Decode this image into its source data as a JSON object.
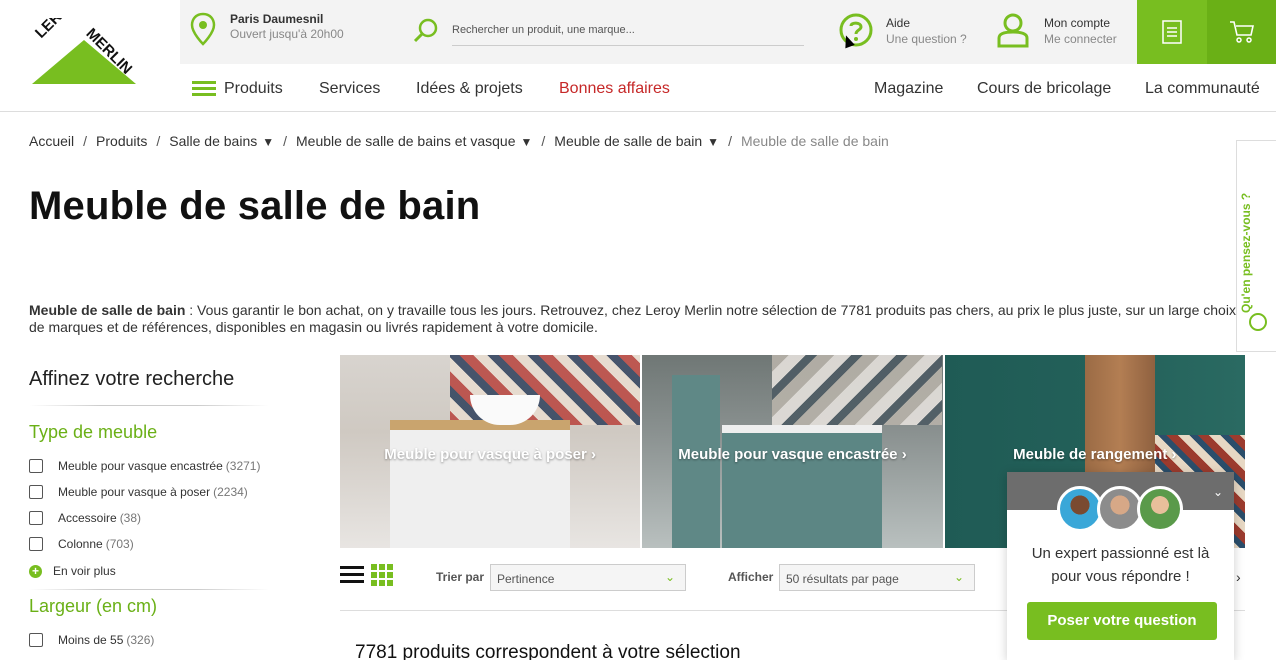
{
  "header": {
    "logo_text": "LEROY MERLIN",
    "store": {
      "name": "Paris Daumesnil",
      "hours": "Ouvert jusqu'à 20h00"
    },
    "search": {
      "placeholder": "Rechercher un produit, une marque..."
    },
    "help": {
      "title": "Aide",
      "subtitle": "Une question ?"
    },
    "account": {
      "title": "Mon compte",
      "subtitle": "Me connecter"
    },
    "colors": {
      "brand_green": "#78be20",
      "deals_red": "#c62828"
    }
  },
  "nav": {
    "products": "Produits",
    "services": "Services",
    "ideas": "Idées & projets",
    "deals": "Bonnes affaires",
    "magazine": "Magazine",
    "courses": "Cours de bricolage",
    "community": "La communauté"
  },
  "breadcrumb": {
    "items": [
      "Accueil",
      "Produits",
      "Salle de bains",
      "Meuble de salle de bains et vasque",
      "Meuble de salle de bain"
    ],
    "current": "Meuble de salle de bain"
  },
  "page": {
    "title": "Meuble de salle de bain",
    "intro_bold": "Meuble de salle de bain",
    "intro_text": " : Vous garantir le bon achat, on y travaille tous les jours. Retrouvez, chez Leroy Merlin notre sélection de 7781 produits pas chers, au prix le plus juste, sur un large choix de marques et de références, disponibles en magasin ou livrés rapidement à votre domicile."
  },
  "feedback_tab": {
    "label": "Qu'en pensez-vous ?"
  },
  "filters": {
    "heading": "Affinez votre recherche",
    "type": {
      "title": "Type de meuble",
      "options": [
        {
          "label": "Meuble pour vasque encastrée",
          "count": "(3271)"
        },
        {
          "label": "Meuble pour vasque à poser",
          "count": "(2234)"
        },
        {
          "label": "Accessoire",
          "count": "(38)"
        },
        {
          "label": "Colonne",
          "count": "(703)"
        }
      ],
      "more": "En voir plus"
    },
    "width": {
      "title": "Largeur (en cm)",
      "options": [
        {
          "label": "Moins de 55",
          "count": "(326)"
        }
      ]
    }
  },
  "categories": [
    {
      "label": "Meuble pour vasque à poser ›"
    },
    {
      "label": "Meuble pour vasque encastrée ›"
    },
    {
      "label": "Meuble de rangement ›"
    }
  ],
  "sort": {
    "sort_label": "Trier par",
    "sort_value": "Pertinence",
    "display_label": "Afficher",
    "display_value": "50 résultats par page",
    "next": "›"
  },
  "results": {
    "text": "7781 produits correspondent à votre sélection"
  },
  "chat": {
    "message": "Un expert passionné est là pour vous répondre !",
    "button": "Poser votre question"
  }
}
